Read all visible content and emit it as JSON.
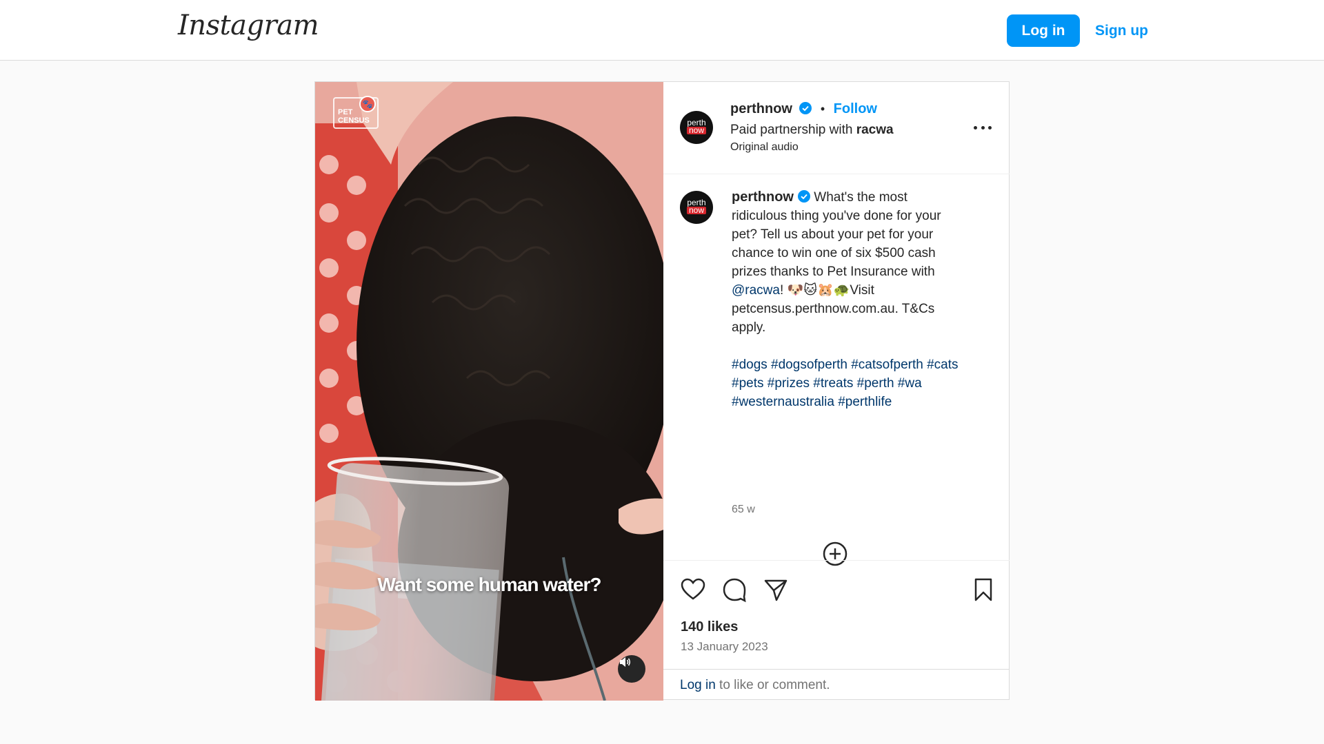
{
  "topbar": {
    "logo_text": "Instagram",
    "login_label": "Log in",
    "signup_label": "Sign up"
  },
  "media": {
    "overlay_caption": "Want some human water?",
    "logo_text_line1": "PET",
    "logo_text_line2": "CENSUS",
    "mute_icon": "speaker-icon"
  },
  "post": {
    "username": "perthnow",
    "avatar_text_top": "perth",
    "avatar_text_bottom": "now",
    "follow_label": "Follow",
    "partnership_prefix": "Paid partnership with ",
    "partnership_name": "racwa",
    "audio_label": "Original audio",
    "caption_part1": " What's the most ridiculous thing you've done for your pet? Tell us about your pet for your chance to win one of six $500 cash prizes thanks to Pet Insurance with ",
    "caption_mention": "@racwa",
    "caption_part2": "! 🐶🐱🐹🐢Visit petcensus.perthnow.com.au. T&Cs apply.",
    "hashtags": "#dogs #dogsofperth #catsofperth #cats #pets #prizes #treats #perth #wa #westernaustralia #perthlife",
    "time_ago": "65 w",
    "likes": "140 likes",
    "date": "13 January 2023",
    "login_link": "Log in",
    "login_suffix": " to like or comment."
  },
  "colors": {
    "accent": "#0095f6",
    "link_dark": "#00376b",
    "muted": "#737373"
  }
}
